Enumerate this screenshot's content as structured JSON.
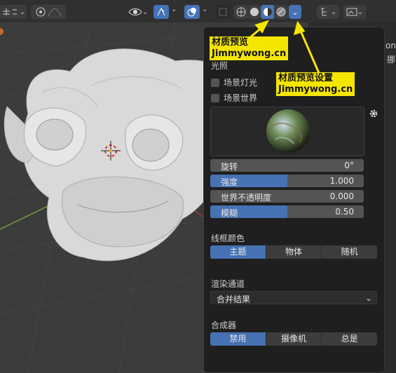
{
  "colors": {
    "accent": "#4772b3",
    "annotation": "#f5e600",
    "popover_bg": "#1f1f1f"
  },
  "header": {
    "icons": [
      "viewport-gizmo-icon",
      "overlay-icon",
      "curve-icon",
      "visibility-icon",
      "gizmo-arrow-icon",
      "overlays-icon",
      "xray-icon",
      "wireframe-shading-icon",
      "solid-shading-icon",
      "material-preview-icon",
      "rendered-shading-icon",
      "shading-options-icon",
      "editor-type-icon",
      "display-mode-icon"
    ]
  },
  "sidebar": {
    "partial_text_1": "on",
    "partial_text_2": "挪"
  },
  "popover": {
    "lighting_title": "光照",
    "scene_lights_label": "场景灯光",
    "scene_world_label": "场景世界",
    "rotation": {
      "label": "旋转",
      "value": "0°",
      "fraction": 0
    },
    "strength": {
      "label": "强度",
      "value": "1.000",
      "fraction": 0.5
    },
    "world_opacity": {
      "label": "世界不透明度",
      "value": "0.000",
      "fraction": 0
    },
    "blur": {
      "label": "模糊",
      "value": "0.50",
      "fraction": 0.5
    },
    "wireframe_title": "线框颜色",
    "wireframe_options": [
      "主题",
      "物体",
      "随机"
    ],
    "wireframe_selected": "主题",
    "render_pass_title": "渲染通道",
    "render_pass_value": "合并结果",
    "compositor_title": "合成器",
    "compositor_options": [
      "禁用",
      "摄像机",
      "总是"
    ],
    "compositor_selected": "禁用"
  },
  "annotations": {
    "a1_line1": "材质预览",
    "a1_line2": "Jimmywong.cn",
    "a2_line1": "材质预览设置",
    "a2_line2": "Jimmywong.cn"
  }
}
